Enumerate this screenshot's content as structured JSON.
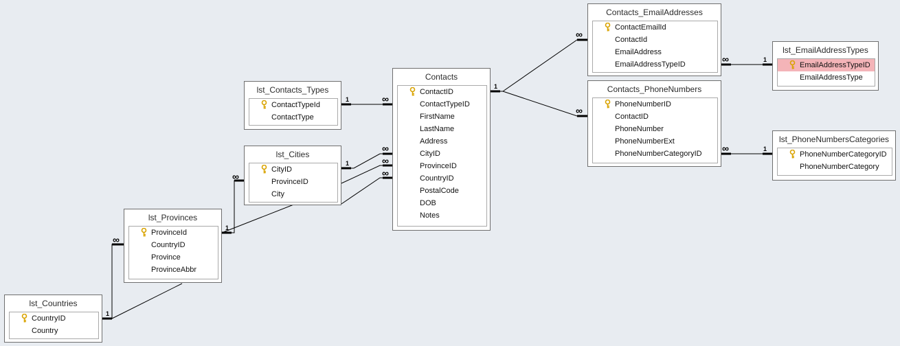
{
  "tables": {
    "lst_contacts_types": {
      "title": "lst_Contacts_Types",
      "fields": [
        {
          "name": "ContactTypeId",
          "key": true
        },
        {
          "name": "ContactType",
          "key": false
        }
      ]
    },
    "lst_cities": {
      "title": "lst_Cities",
      "fields": [
        {
          "name": "CityID",
          "key": true
        },
        {
          "name": "ProvinceID",
          "key": false
        },
        {
          "name": "City",
          "key": false
        }
      ]
    },
    "lst_provinces": {
      "title": "lst_Provinces",
      "fields": [
        {
          "name": "ProvinceId",
          "key": true
        },
        {
          "name": "CountryID",
          "key": false
        },
        {
          "name": "Province",
          "key": false
        },
        {
          "name": "ProvinceAbbr",
          "key": false
        }
      ]
    },
    "lst_countries": {
      "title": "lst_Countries",
      "fields": [
        {
          "name": "CountryID",
          "key": true
        },
        {
          "name": "Country",
          "key": false
        }
      ]
    },
    "contacts": {
      "title": "Contacts",
      "fields": [
        {
          "name": "ContactID",
          "key": true
        },
        {
          "name": "ContactTypeID",
          "key": false
        },
        {
          "name": "FirstName",
          "key": false
        },
        {
          "name": "LastName",
          "key": false
        },
        {
          "name": "Address",
          "key": false
        },
        {
          "name": "CityID",
          "key": false
        },
        {
          "name": "ProvinceID",
          "key": false
        },
        {
          "name": "CountryID",
          "key": false
        },
        {
          "name": "PostalCode",
          "key": false
        },
        {
          "name": "DOB",
          "key": false
        },
        {
          "name": "Notes",
          "key": false
        }
      ]
    },
    "contacts_emailaddresses": {
      "title": "Contacts_EmailAddresses",
      "fields": [
        {
          "name": "ContactEmailId",
          "key": true
        },
        {
          "name": "ContactId",
          "key": false
        },
        {
          "name": "EmailAddress",
          "key": false
        },
        {
          "name": "EmailAddressTypeID",
          "key": false
        }
      ]
    },
    "lst_emailaddresstypes": {
      "title": "lst_EmailAddressTypes",
      "fields": [
        {
          "name": "EmailAddressTypeID",
          "key": true,
          "selected": true
        },
        {
          "name": "EmailAddressType",
          "key": false
        }
      ]
    },
    "contacts_phonenumbers": {
      "title": "Contacts_PhoneNumbers",
      "fields": [
        {
          "name": "PhoneNumberID",
          "key": true
        },
        {
          "name": "ContactID",
          "key": false
        },
        {
          "name": "PhoneNumber",
          "key": false
        },
        {
          "name": "PhoneNumberExt",
          "key": false
        },
        {
          "name": "PhoneNumberCategoryID",
          "key": false
        }
      ]
    },
    "lst_phonenumberscategories": {
      "title": "lst_PhoneNumbersCategories",
      "fields": [
        {
          "name": "PhoneNumberCategoryID",
          "key": true
        },
        {
          "name": "PhoneNumberCategory",
          "key": false
        }
      ]
    }
  },
  "relationship_labels": {
    "one": "1",
    "many": "∞"
  },
  "colors": {
    "background": "#e8ecf1",
    "selected_field": "#f4b4b8",
    "key_icon": "#d9a300",
    "line": "#000000"
  }
}
